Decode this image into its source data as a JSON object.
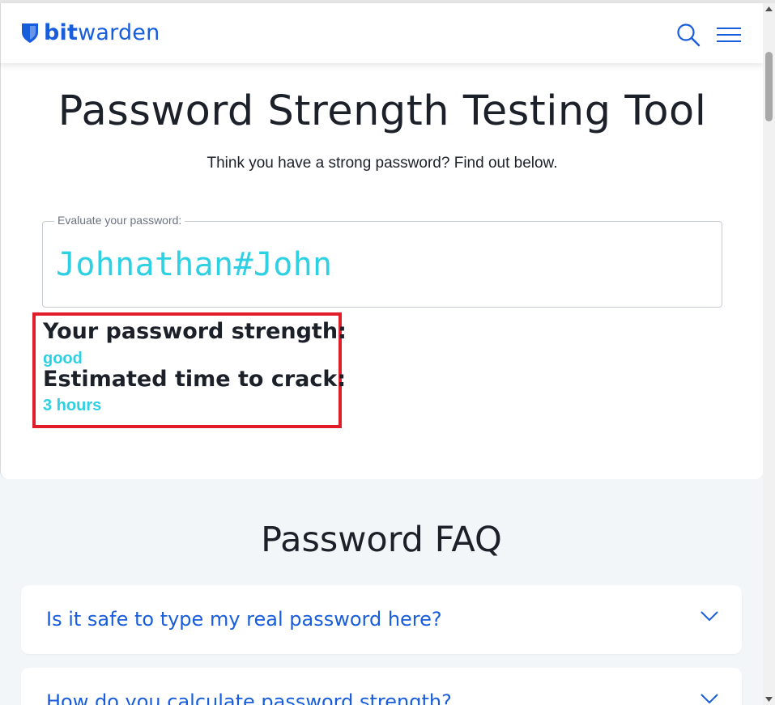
{
  "brand": {
    "name_bold": "bit",
    "name_rest": "warden",
    "accent": "#175ddc"
  },
  "header": {
    "search_icon": "search-icon",
    "menu_icon": "hamburger-menu-icon"
  },
  "hero": {
    "title": "Password Strength Testing Tool",
    "subtitle": "Think you have a strong password? Find out below."
  },
  "password_field": {
    "label": "Evaluate your password:",
    "value": "Johnathan#John"
  },
  "result": {
    "strength_label": "Your password strength:",
    "strength_value": "good",
    "crack_label": "Estimated time to crack:",
    "crack_value": "3 hours",
    "value_color": "#2ed0e3",
    "highlight_color": "#e11d2a"
  },
  "faq": {
    "title": "Password FAQ",
    "items": [
      {
        "question": "Is it safe to type my real password here?"
      },
      {
        "question": "How do you calculate password strength?"
      }
    ]
  }
}
